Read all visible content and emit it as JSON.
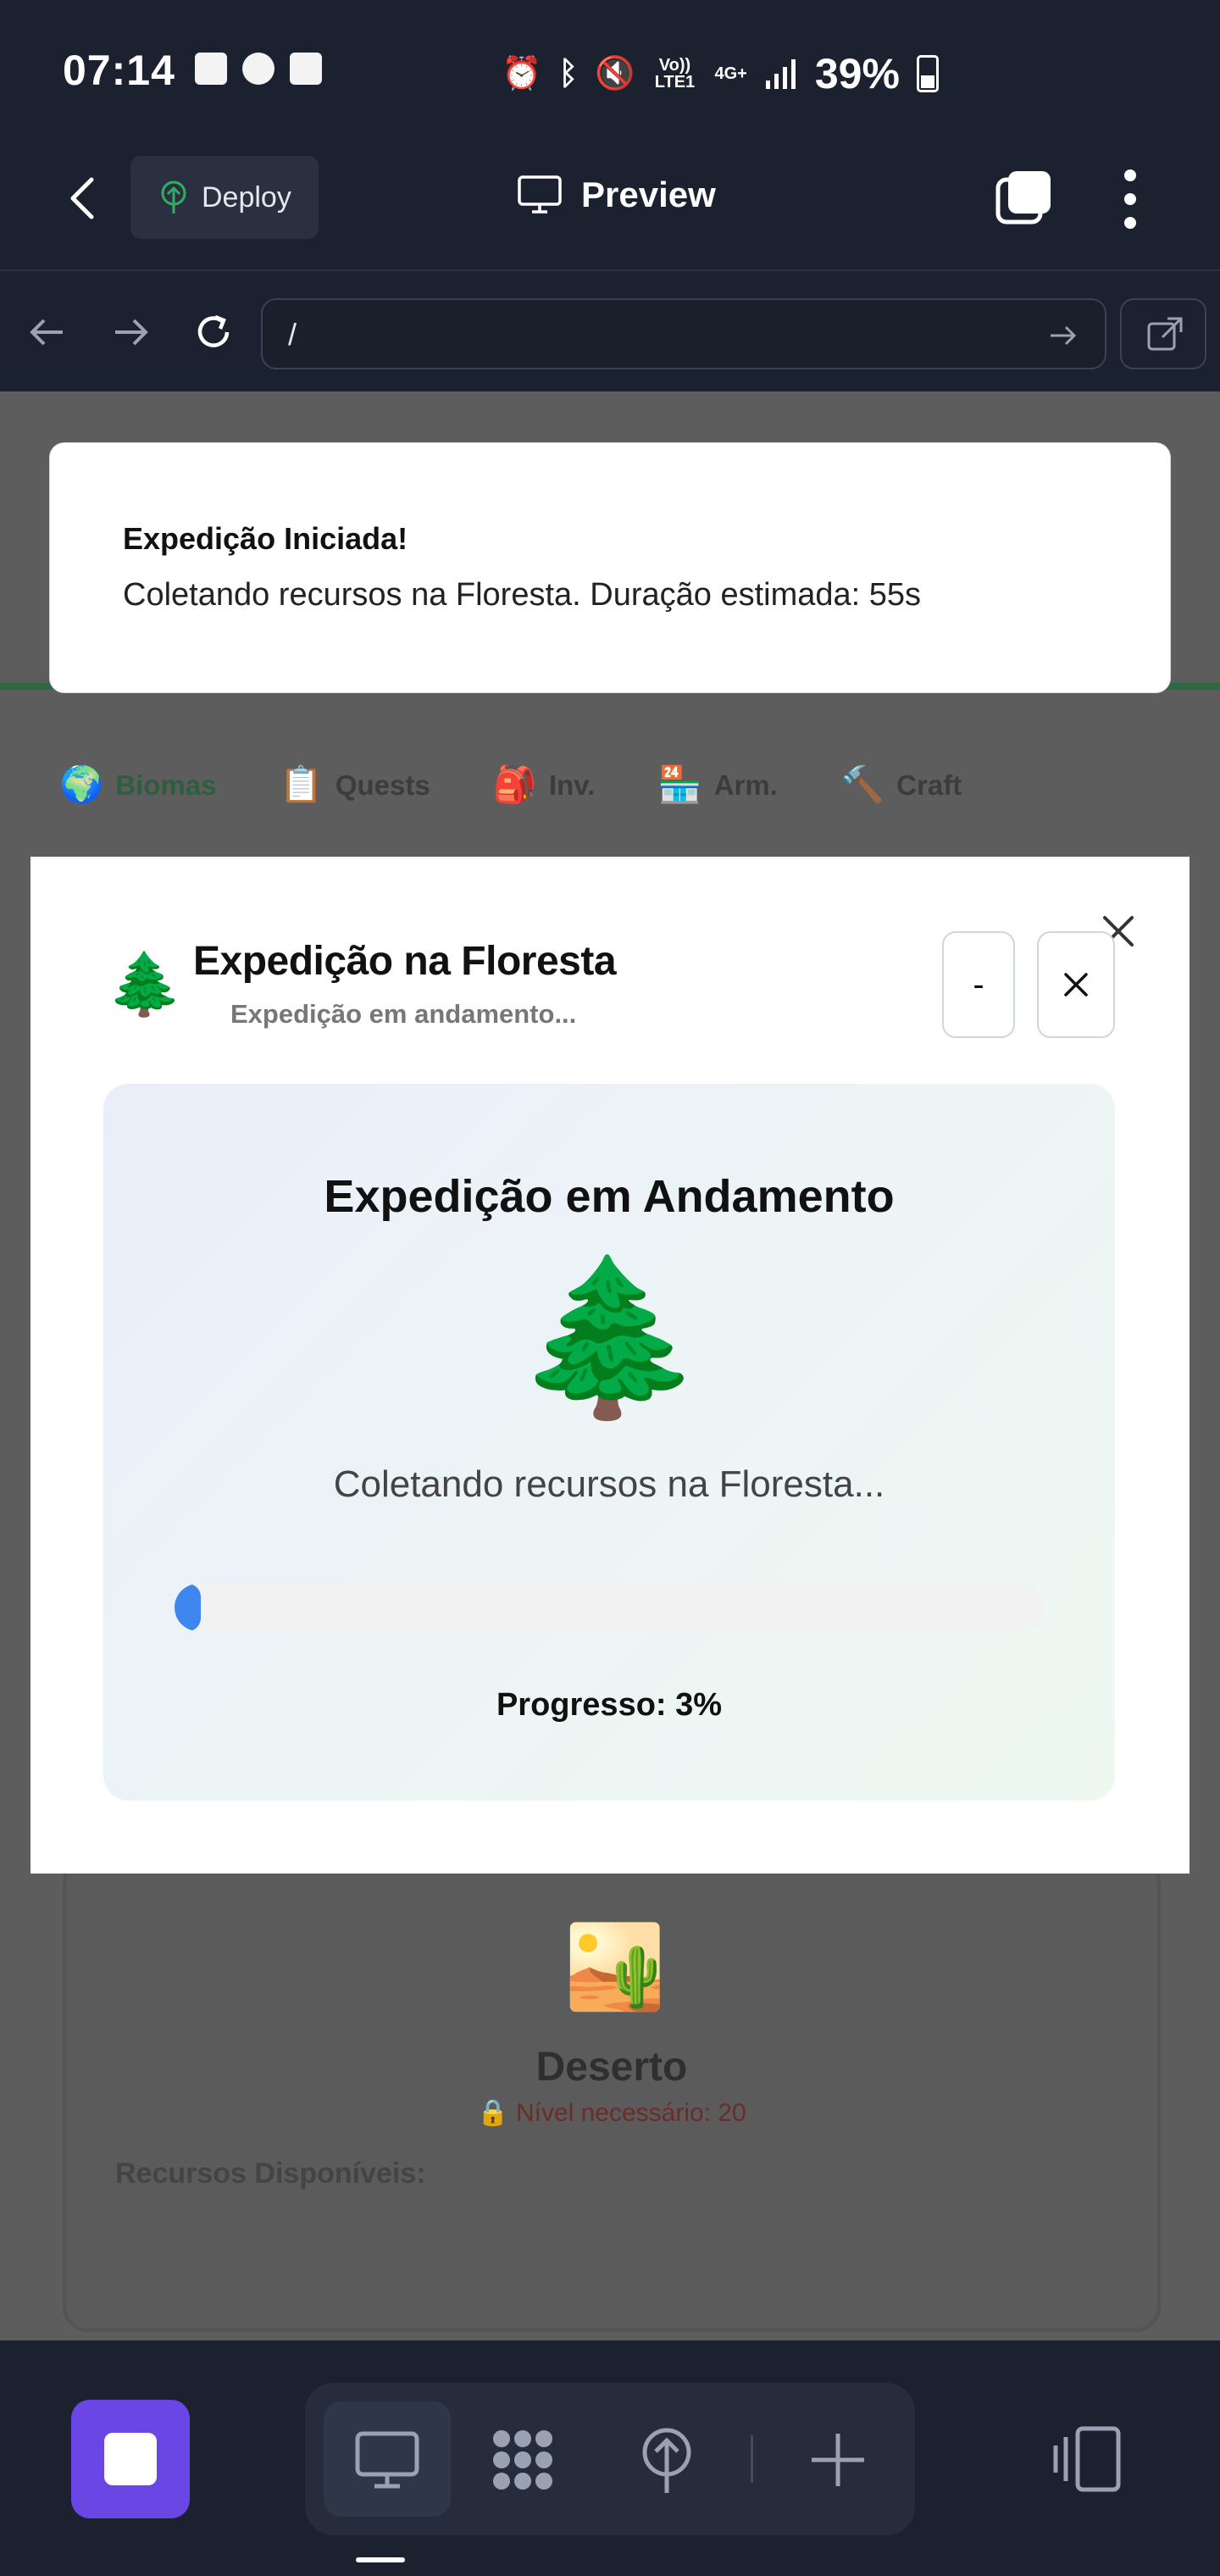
{
  "status_bar": {
    "time": "07:14",
    "network": "Vo)) LTE1",
    "network2": "4G+",
    "battery": "39%",
    "battery_level": 0.39
  },
  "app_header": {
    "deploy_label": "Deploy",
    "preview_label": "Preview"
  },
  "browser": {
    "url": "/"
  },
  "toast": {
    "title": "Expedição Iniciada!",
    "body": "Coletando recursos na Floresta. Duração estimada: 55s"
  },
  "page_tabs": [
    {
      "emoji": "🌍",
      "label": "Biomas",
      "active": true
    },
    {
      "emoji": "📋",
      "label": "Quests",
      "active": false
    },
    {
      "emoji": "🎒",
      "label": "Inv.",
      "active": false
    },
    {
      "emoji": "🏪",
      "label": "Arm.",
      "active": false
    },
    {
      "emoji": "🔨",
      "label": "Craft",
      "active": false
    }
  ],
  "biome_card": {
    "emoji": "🏜️",
    "name": "Deserto",
    "level_required": "🔒 Nível necessário: 20",
    "resources_label": "Recursos Disponíveis:"
  },
  "modal": {
    "emoji": "🌲",
    "title": "Expedição na Floresta",
    "subtitle": "Expedição em andamento...",
    "minimize_label": "-",
    "expedition": {
      "heading": "Expedição em Andamento",
      "emoji": "🌲",
      "message": "Coletando recursos na Floresta...",
      "progress": 3,
      "progress_label": "Progresso: 3%"
    }
  },
  "colors": {
    "accent_purple": "#6a46e4",
    "progress_blue": "#3f86ee",
    "dark_bg": "#1c2130",
    "active_tab_green": "#2d5e3f"
  }
}
